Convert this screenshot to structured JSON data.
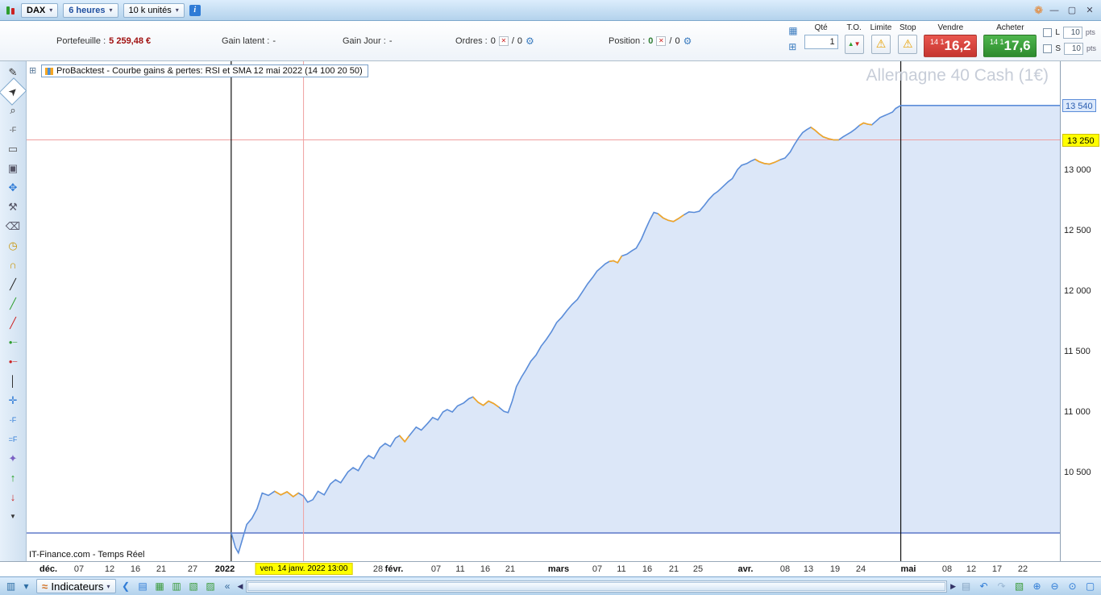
{
  "icons": {
    "caret": "▾",
    "info": "i",
    "minimize": "—",
    "maximize": "▢",
    "close": "✕",
    "prt_logo": "❁",
    "keyboard": "▦",
    "calculator": "⊞",
    "red_x": "✕",
    "gear": "⚙",
    "to_up": "▲",
    "to_down": "▼",
    "warning": "⚠",
    "window": "⊞",
    "wave": "≈",
    "scroll_left": "◀",
    "scroll_right": "▶"
  },
  "titlebar": {
    "instrument": "DAX",
    "timeframe": "6 heures",
    "units": "10 k unités"
  },
  "toolbar": {
    "portfolio_label": "Portefeuille :",
    "portfolio_value": "5 259,48 €",
    "gain_latent_label": "Gain latent :",
    "gain_latent_value": "-",
    "gain_jour_label": "Gain Jour :",
    "gain_jour_value": "-",
    "ordres_label": "Ordres :",
    "ordres_count": "0",
    "sep": "/",
    "ordres_count2": "0",
    "position_label": "Position :",
    "position_count": "0",
    "position_count2": "0",
    "qty_label": "Qté",
    "qty_value": "1",
    "to_label": "T.O.",
    "limite_label": "Limite",
    "stop_label": "Stop",
    "sell_label": "Vendre",
    "buy_label": "Acheter",
    "sell_price_small": "14 1",
    "sell_price_big": "16,2",
    "buy_price_small": "14 1",
    "buy_price_big": "17,6",
    "l_label": "L",
    "s_label": "S",
    "l_value": "10",
    "s_value": "10",
    "pts_label": "pts"
  },
  "left_toolbar": {
    "tools": [
      {
        "name": "draw-pencil-icon",
        "glyph": "✎",
        "color": "#333"
      },
      {
        "name": "cursor-icon",
        "glyph": "➤",
        "color": "#333",
        "selected": true,
        "rot": true
      },
      {
        "name": "zoom-tool-icon",
        "glyph": "⌕",
        "color": "#333"
      },
      {
        "name": "fibonacci-retracement-icon",
        "glyph": "-F",
        "color": "#555",
        "size": 9
      },
      {
        "name": "measure-icon",
        "glyph": "▭",
        "color": "#555"
      },
      {
        "name": "duplicate-icon",
        "glyph": "▣",
        "color": "#556"
      },
      {
        "name": "move-icon",
        "glyph": "✥",
        "color": "#2f7bd6"
      },
      {
        "name": "tools-icon",
        "glyph": "⚒",
        "color": "#556"
      },
      {
        "name": "delete-icon",
        "glyph": "⌫",
        "color": "#556"
      },
      {
        "name": "alarm-clock-icon",
        "glyph": "◷",
        "color": "#c8960c"
      },
      {
        "name": "alert-bell-icon",
        "glyph": "∩",
        "color": "#c8960c"
      },
      {
        "name": "trendline-icon",
        "glyph": "╱",
        "color": "#222"
      },
      {
        "name": "trendline-green-icon",
        "glyph": "╱",
        "color": "#2f9e2f"
      },
      {
        "name": "trendline-red-icon",
        "glyph": "╱",
        "color": "#cc2222"
      },
      {
        "name": "horizontal-segment-green-icon",
        "glyph": "●─",
        "color": "#2f9e2f",
        "size": 8
      },
      {
        "name": "horizontal-segment-red-icon",
        "glyph": "●─",
        "color": "#cc2222",
        "size": 8
      },
      {
        "name": "vertical-line-icon",
        "glyph": "│",
        "color": "#222"
      },
      {
        "name": "cross-lines-icon",
        "glyph": "✛",
        "color": "#2f7bd6"
      },
      {
        "name": "fibonacci-fan-icon",
        "glyph": "-F",
        "color": "#2f7bd6",
        "size": 9
      },
      {
        "name": "fibonacci-extension-icon",
        "glyph": "=F",
        "color": "#2f7bd6",
        "size": 9
      },
      {
        "name": "pattern-icon",
        "glyph": "✦",
        "color": "#7b61c4"
      },
      {
        "name": "buy-arrow-icon",
        "glyph": "↑",
        "color": "#1e9e1e"
      },
      {
        "name": "sell-arrow-icon",
        "glyph": "↓",
        "color": "#cc2222"
      },
      {
        "name": "collapse-tools-icon",
        "glyph": "▼",
        "color": "#333",
        "size": 8
      }
    ]
  },
  "bottom_bar": {
    "indicateurs_label": "Indicateurs",
    "pre_icons": [
      {
        "name": "chart-style-icon",
        "glyph": "▥",
        "color": "#2e6da4"
      },
      {
        "name": "chart-style-caret-icon",
        "glyph": "▾",
        "color": "#2e6da4"
      }
    ],
    "mid_icons": [
      {
        "name": "share-icon",
        "glyph": "❮",
        "color": "#2f7bd6"
      },
      {
        "name": "news-icon",
        "glyph": "▤",
        "color": "#2f7bd6"
      },
      {
        "name": "orders-log-icon",
        "glyph": "▦",
        "color": "#3a9a3a"
      },
      {
        "name": "positions-icon",
        "glyph": "▥",
        "color": "#3a9a3a"
      },
      {
        "name": "screener-icon",
        "glyph": "▧",
        "color": "#3a9a3a"
      },
      {
        "name": "chart-edit-icon",
        "glyph": "▨",
        "color": "#3a9a3a"
      },
      {
        "name": "collapse-icon",
        "glyph": "«",
        "color": "#336699"
      }
    ],
    "right_icons": [
      {
        "name": "detach-page-icon",
        "glyph": "▤",
        "color": "#88a5c2"
      },
      {
        "name": "undo-icon",
        "glyph": "↶",
        "color": "#2f7bd6"
      },
      {
        "name": "redo-icon",
        "glyph": "↷",
        "color": "#9ab7d4"
      },
      {
        "name": "zoom-chart-icon",
        "glyph": "▧",
        "color": "#3a9a3a"
      },
      {
        "name": "zoom-in-icon",
        "glyph": "⊕",
        "color": "#2f7bd6"
      },
      {
        "name": "zoom-out-icon",
        "glyph": "⊖",
        "color": "#2f7bd6"
      },
      {
        "name": "magnifier-icon",
        "glyph": "⊙",
        "color": "#2f7bd6"
      },
      {
        "name": "fullscreen-icon",
        "glyph": "▢",
        "color": "#2f7bd6"
      }
    ]
  },
  "chart_data": {
    "type": "area",
    "title": "ProBacktest - Courbe gains & pertes: RSI et SMA 12 mai 2022 (14 100 20 50)",
    "watermark": "Allemagne 40 Cash (1€)",
    "footer": "IT-Finance.com - Temps Réel",
    "ylim": [
      9767,
      13900
    ],
    "baseline": 10000,
    "grid": false,
    "legend": false,
    "colors": {
      "line": "#5b8dd9",
      "fill": "#dce7f8",
      "alt": "#f5a623",
      "baseline": "#2b4db8",
      "crosshair": "#f0a0a0",
      "event_line": "#111111"
    },
    "vlines": [
      0.198,
      0.846
    ],
    "crosshair": {
      "f": 0.268,
      "value": 13250,
      "label": "ven. 14 janv. 2022 13:00"
    },
    "y_axis": {
      "ticks": [
        {
          "label": "13 540",
          "value": 13533,
          "style": "blue-badge"
        },
        {
          "label": "13 250",
          "value": 13250,
          "style": "yellow-badge"
        },
        {
          "label": "13 000",
          "value": 13000
        },
        {
          "label": "12 500",
          "value": 12500
        },
        {
          "label": "12 000",
          "value": 12000
        },
        {
          "label": "11 500",
          "value": 11500
        },
        {
          "label": "11 000",
          "value": 11000
        },
        {
          "label": "10 500",
          "value": 10500
        }
      ]
    },
    "x_axis": {
      "ticks": [
        {
          "label": "déc.",
          "f": 0.021,
          "bold": true
        },
        {
          "label": "07",
          "f": 0.051
        },
        {
          "label": "12",
          "f": 0.08
        },
        {
          "label": "16",
          "f": 0.105
        },
        {
          "label": "21",
          "f": 0.13
        },
        {
          "label": "27",
          "f": 0.161
        },
        {
          "label": "2022",
          "f": 0.192,
          "bold": true
        },
        {
          "label": "28",
          "f": 0.34
        },
        {
          "label": "févr.",
          "f": 0.356,
          "bold": true
        },
        {
          "label": "07",
          "f": 0.396
        },
        {
          "label": "11",
          "f": 0.42
        },
        {
          "label": "16",
          "f": 0.444
        },
        {
          "label": "21",
          "f": 0.468
        },
        {
          "label": "mars",
          "f": 0.515,
          "bold": true
        },
        {
          "label": "07",
          "f": 0.552
        },
        {
          "label": "11",
          "f": 0.576
        },
        {
          "label": "16",
          "f": 0.601
        },
        {
          "label": "21",
          "f": 0.626
        },
        {
          "label": "25",
          "f": 0.65
        },
        {
          "label": "avr.",
          "f": 0.696,
          "bold": true
        },
        {
          "label": "08",
          "f": 0.734
        },
        {
          "label": "13",
          "f": 0.757
        },
        {
          "label": "19",
          "f": 0.782
        },
        {
          "label": "24",
          "f": 0.807
        },
        {
          "label": "mai",
          "f": 0.853,
          "bold": true
        },
        {
          "label": "08",
          "f": 0.891
        },
        {
          "label": "12",
          "f": 0.914
        },
        {
          "label": "17",
          "f": 0.939
        },
        {
          "label": "22",
          "f": 0.964
        }
      ]
    },
    "orange_segments": [
      [
        0.24,
        0.263
      ],
      [
        0.361,
        0.372
      ],
      [
        0.432,
        0.457
      ],
      [
        0.564,
        0.576
      ],
      [
        0.611,
        0.636
      ],
      [
        0.705,
        0.729
      ],
      [
        0.759,
        0.786
      ],
      [
        0.806,
        0.818
      ]
    ],
    "series": [
      {
        "name": "Gains & pertes",
        "color": "#5b8dd9",
        "points": [
          [
            0.198,
            10005
          ],
          [
            0.202,
            9880
          ],
          [
            0.205,
            9835
          ],
          [
            0.209,
            9950
          ],
          [
            0.213,
            10070
          ],
          [
            0.218,
            10120
          ],
          [
            0.223,
            10200
          ],
          [
            0.228,
            10330
          ],
          [
            0.234,
            10310
          ],
          [
            0.24,
            10345
          ],
          [
            0.246,
            10315
          ],
          [
            0.252,
            10340
          ],
          [
            0.258,
            10300
          ],
          [
            0.263,
            10330
          ],
          [
            0.268,
            10305
          ],
          [
            0.272,
            10255
          ],
          [
            0.277,
            10275
          ],
          [
            0.282,
            10345
          ],
          [
            0.288,
            10315
          ],
          [
            0.294,
            10405
          ],
          [
            0.299,
            10440
          ],
          [
            0.304,
            10415
          ],
          [
            0.311,
            10505
          ],
          [
            0.316,
            10540
          ],
          [
            0.321,
            10515
          ],
          [
            0.327,
            10605
          ],
          [
            0.331,
            10640
          ],
          [
            0.336,
            10615
          ],
          [
            0.342,
            10705
          ],
          [
            0.347,
            10740
          ],
          [
            0.352,
            10715
          ],
          [
            0.357,
            10785
          ],
          [
            0.361,
            10805
          ],
          [
            0.366,
            10755
          ],
          [
            0.37,
            10800
          ],
          [
            0.377,
            10875
          ],
          [
            0.382,
            10850
          ],
          [
            0.388,
            10905
          ],
          [
            0.393,
            10955
          ],
          [
            0.398,
            10935
          ],
          [
            0.403,
            11000
          ],
          [
            0.407,
            11020
          ],
          [
            0.412,
            11000
          ],
          [
            0.417,
            11050
          ],
          [
            0.423,
            11075
          ],
          [
            0.428,
            11110
          ],
          [
            0.432,
            11125
          ],
          [
            0.437,
            11080
          ],
          [
            0.442,
            11055
          ],
          [
            0.447,
            11090
          ],
          [
            0.452,
            11070
          ],
          [
            0.457,
            11040
          ],
          [
            0.462,
            11005
          ],
          [
            0.466,
            10995
          ],
          [
            0.47,
            11090
          ],
          [
            0.474,
            11210
          ],
          [
            0.479,
            11290
          ],
          [
            0.483,
            11345
          ],
          [
            0.488,
            11420
          ],
          [
            0.493,
            11470
          ],
          [
            0.498,
            11545
          ],
          [
            0.503,
            11600
          ],
          [
            0.508,
            11665
          ],
          [
            0.513,
            11740
          ],
          [
            0.518,
            11785
          ],
          [
            0.523,
            11840
          ],
          [
            0.528,
            11890
          ],
          [
            0.533,
            11930
          ],
          [
            0.538,
            11995
          ],
          [
            0.543,
            12060
          ],
          [
            0.548,
            12115
          ],
          [
            0.552,
            12165
          ],
          [
            0.556,
            12195
          ],
          [
            0.56,
            12225
          ],
          [
            0.564,
            12245
          ],
          [
            0.568,
            12250
          ],
          [
            0.572,
            12235
          ],
          [
            0.576,
            12290
          ],
          [
            0.581,
            12305
          ],
          [
            0.586,
            12335
          ],
          [
            0.59,
            12355
          ],
          [
            0.595,
            12430
          ],
          [
            0.599,
            12510
          ],
          [
            0.603,
            12585
          ],
          [
            0.607,
            12650
          ],
          [
            0.611,
            12640
          ],
          [
            0.616,
            12605
          ],
          [
            0.621,
            12585
          ],
          [
            0.626,
            12575
          ],
          [
            0.631,
            12600
          ],
          [
            0.636,
            12630
          ],
          [
            0.641,
            12655
          ],
          [
            0.646,
            12650
          ],
          [
            0.651,
            12660
          ],
          [
            0.656,
            12710
          ],
          [
            0.66,
            12755
          ],
          [
            0.665,
            12800
          ],
          [
            0.669,
            12825
          ],
          [
            0.674,
            12865
          ],
          [
            0.679,
            12905
          ],
          [
            0.683,
            12930
          ],
          [
            0.688,
            13005
          ],
          [
            0.692,
            13040
          ],
          [
            0.697,
            13055
          ],
          [
            0.701,
            13075
          ],
          [
            0.705,
            13090
          ],
          [
            0.709,
            13070
          ],
          [
            0.714,
            13055
          ],
          [
            0.719,
            13050
          ],
          [
            0.724,
            13065
          ],
          [
            0.729,
            13085
          ],
          [
            0.734,
            13100
          ],
          [
            0.739,
            13150
          ],
          [
            0.743,
            13210
          ],
          [
            0.747,
            13265
          ],
          [
            0.751,
            13310
          ],
          [
            0.755,
            13335
          ],
          [
            0.759,
            13355
          ],
          [
            0.763,
            13330
          ],
          [
            0.767,
            13300
          ],
          [
            0.771,
            13275
          ],
          [
            0.776,
            13260
          ],
          [
            0.781,
            13250
          ],
          [
            0.786,
            13250
          ],
          [
            0.79,
            13275
          ],
          [
            0.794,
            13295
          ],
          [
            0.798,
            13315
          ],
          [
            0.802,
            13340
          ],
          [
            0.806,
            13370
          ],
          [
            0.81,
            13390
          ],
          [
            0.814,
            13380
          ],
          [
            0.818,
            13375
          ],
          [
            0.822,
            13405
          ],
          [
            0.826,
            13435
          ],
          [
            0.83,
            13450
          ],
          [
            0.834,
            13465
          ],
          [
            0.838,
            13480
          ],
          [
            0.841,
            13510
          ],
          [
            0.845,
            13530
          ],
          [
            0.847,
            13535
          ],
          [
            1.0,
            13535
          ]
        ]
      }
    ]
  }
}
